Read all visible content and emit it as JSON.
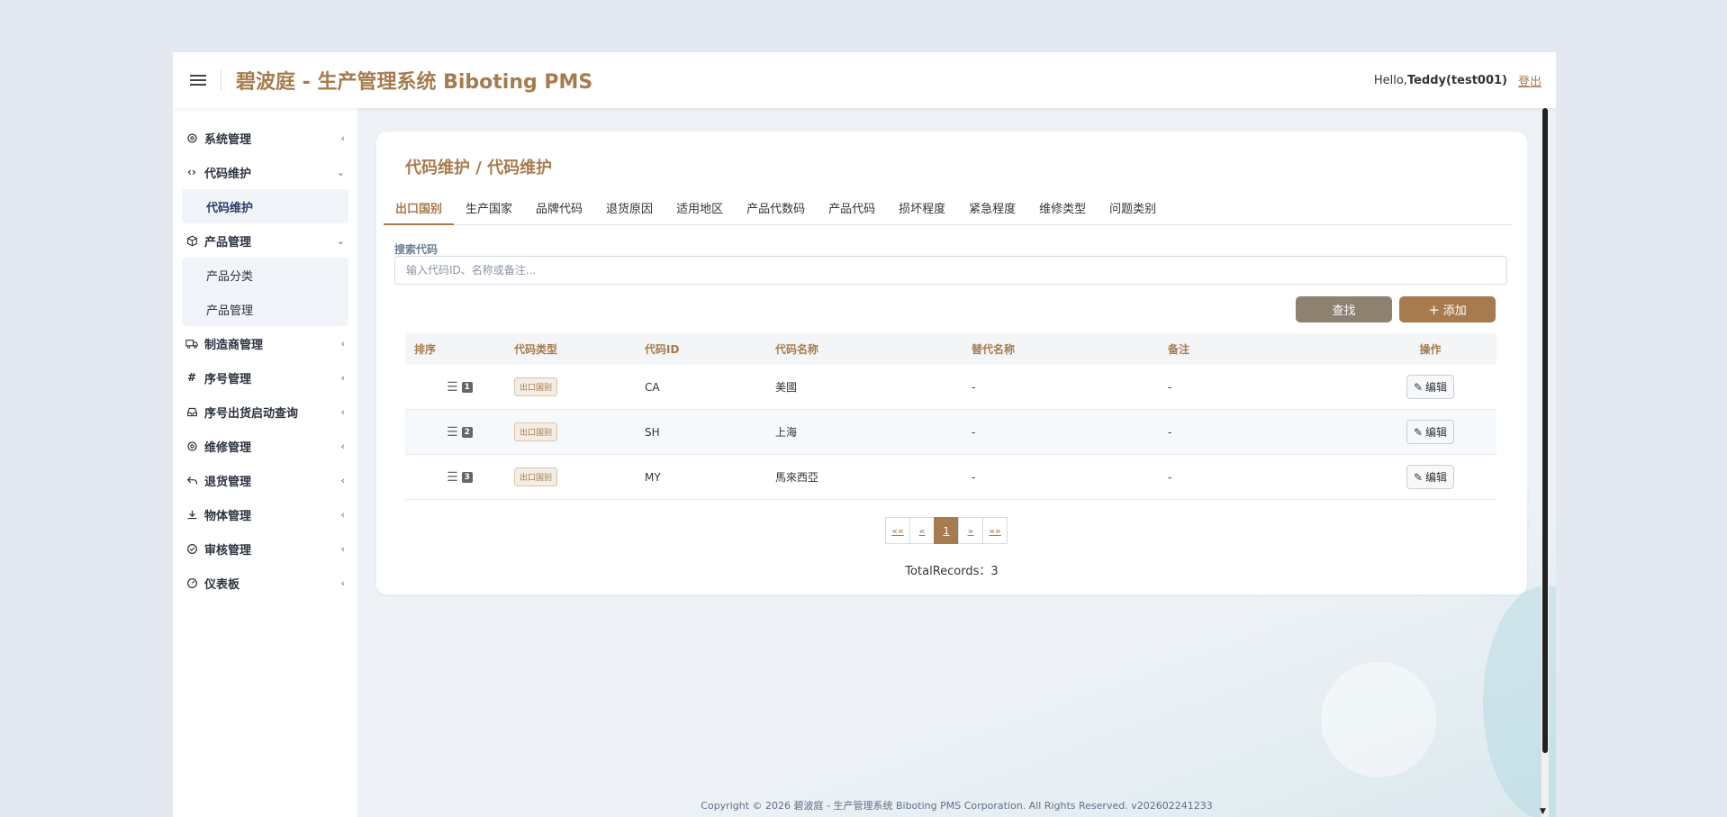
{
  "header": {
    "title": "碧波庭 - 生产管理系统 Biboting PMS",
    "greeting_prefix": "Hello,",
    "user": "Teddy(test001)",
    "logout": "登出"
  },
  "sidebar": {
    "items": [
      {
        "label": "系统管理",
        "icon": "gear-icon"
      },
      {
        "label": "代码维护",
        "icon": "code-icon",
        "expanded": true,
        "children": [
          {
            "label": "代码维护"
          }
        ]
      },
      {
        "label": "产品管理",
        "icon": "cube-icon",
        "expanded": true,
        "children": [
          {
            "label": "产品分类"
          },
          {
            "label": "产品管理"
          }
        ]
      },
      {
        "label": "制造商管理",
        "icon": "truck-icon"
      },
      {
        "label": "序号管理",
        "icon": "hash-icon"
      },
      {
        "label": "序号出货启动查询",
        "icon": "inbox-icon"
      },
      {
        "label": "维修管理",
        "icon": "gear-icon"
      },
      {
        "label": "退货管理",
        "icon": "return-icon"
      },
      {
        "label": "物体管理",
        "icon": "download-icon"
      },
      {
        "label": "审核管理",
        "icon": "check-circle-icon"
      },
      {
        "label": "仪表板",
        "icon": "dashboard-icon"
      }
    ]
  },
  "page": {
    "title": "代码维护 / 代码维护",
    "tabs": [
      "出口国别",
      "生产国家",
      "品牌代码",
      "退货原因",
      "适用地区",
      "产品代数码",
      "产品代码",
      "损坏程度",
      "紧急程度",
      "维修类型",
      "问题类别"
    ],
    "active_tab": 0,
    "search": {
      "label": "搜索代码",
      "placeholder": "输入代码ID、名称或备注...",
      "value": ""
    },
    "buttons": {
      "find": "查找",
      "add": "添加"
    },
    "table": {
      "headers": [
        "排序",
        "代码类型",
        "代码ID",
        "代码名称",
        "替代名称",
        "备注",
        "操作"
      ],
      "rows": [
        {
          "order": "1",
          "type": "出口国别",
          "id": "CA",
          "name": "美國",
          "alt": "-",
          "note": "-",
          "action": "编辑"
        },
        {
          "order": "2",
          "type": "出口国别",
          "id": "SH",
          "name": "上海",
          "alt": "-",
          "note": "-",
          "action": "编辑"
        },
        {
          "order": "3",
          "type": "出口国别",
          "id": "MY",
          "name": "馬來西亞",
          "alt": "-",
          "note": "-",
          "action": "编辑"
        }
      ]
    },
    "pagination": {
      "first": "««",
      "prev": "«",
      "current": "1",
      "next": "»",
      "last": "»»"
    },
    "total": "TotalRecords：3"
  },
  "footer": "Copyright © 2026  碧波庭 - 生产管理系统  Biboting PMS Corporation. All Rights Reserved.  v202602241233",
  "colors": {
    "accent": "#a67c4e",
    "find_button": "#8d8170",
    "background": "#e4e9f1"
  }
}
